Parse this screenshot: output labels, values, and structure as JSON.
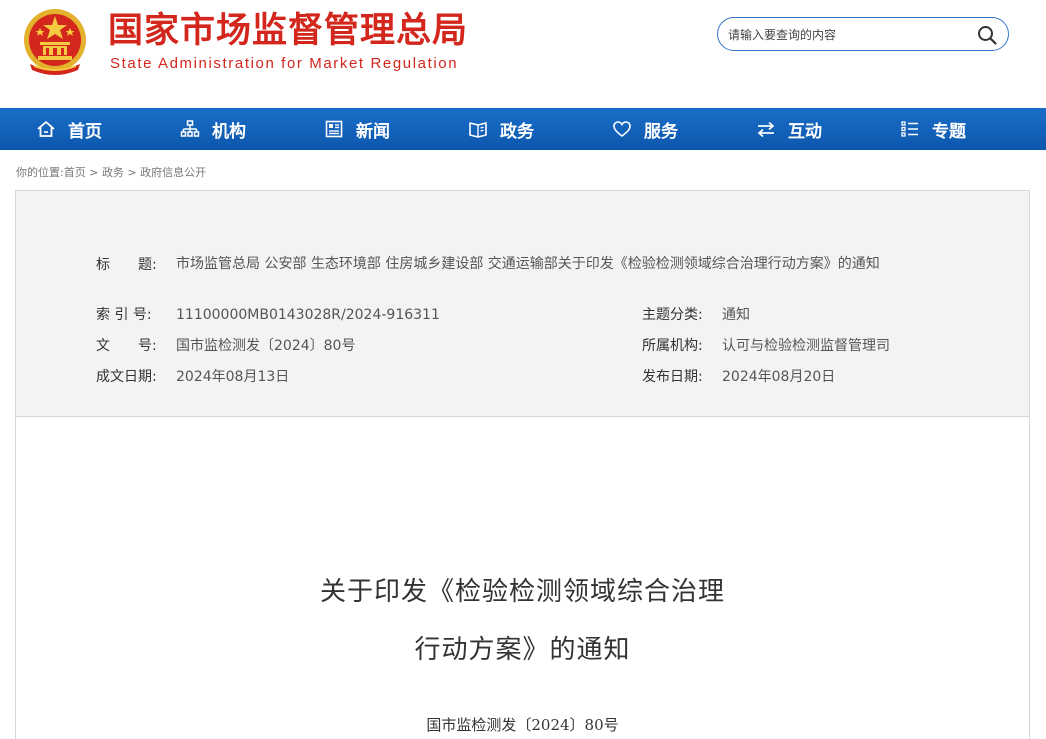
{
  "header": {
    "title_cn": "国家市场监督管理总局",
    "title_en": "State Administration for Market Regulation",
    "emblem_icon": "national-emblem-icon",
    "search": {
      "placeholder": "请输入要查询的内容",
      "icon": "search-icon"
    }
  },
  "nav": {
    "items": [
      {
        "label": "首页",
        "icon": "home-icon"
      },
      {
        "label": "机构",
        "icon": "org-chart-icon"
      },
      {
        "label": "新闻",
        "icon": "newspaper-icon"
      },
      {
        "label": "政务",
        "icon": "book-icon"
      },
      {
        "label": "服务",
        "icon": "heart-icon"
      },
      {
        "label": "互动",
        "icon": "exchange-icon"
      },
      {
        "label": "专题",
        "icon": "list-icon"
      }
    ]
  },
  "breadcrumb": {
    "prefix": "你的位置:",
    "items": [
      "首页",
      "政务",
      "政府信息公开"
    ],
    "separator": ">"
  },
  "meta": {
    "title_label": "标　　题:",
    "title_value": "市场监管总局 公安部 生态环境部 住房城乡建设部 交通运输部关于印发《检验检测领域综合治理行动方案》的通知",
    "index_label": "索 引 号:",
    "index_value": "11100000MB0143028R/2024-916311",
    "topic_label": "主题分类:",
    "topic_value": "通知",
    "docno_label": "文　　号:",
    "docno_value": "国市监检测发〔2024〕80号",
    "agency_label": "所属机构:",
    "agency_value": "认可与检验检测监督管理司",
    "created_label": "成文日期:",
    "created_value": "2024年08月13日",
    "published_label": "发布日期:",
    "published_value": "2024年08月20日"
  },
  "document": {
    "heading_line1": "关于印发《检验检测领域综合治理",
    "heading_line2": "行动方案》的通知",
    "doc_number": "国市监检测发〔2024〕80号"
  },
  "colors": {
    "brand_red": "#d3261d",
    "nav_blue": "#0d57ad",
    "search_border": "#3474c8",
    "meta_bg": "#f3f3f3"
  }
}
